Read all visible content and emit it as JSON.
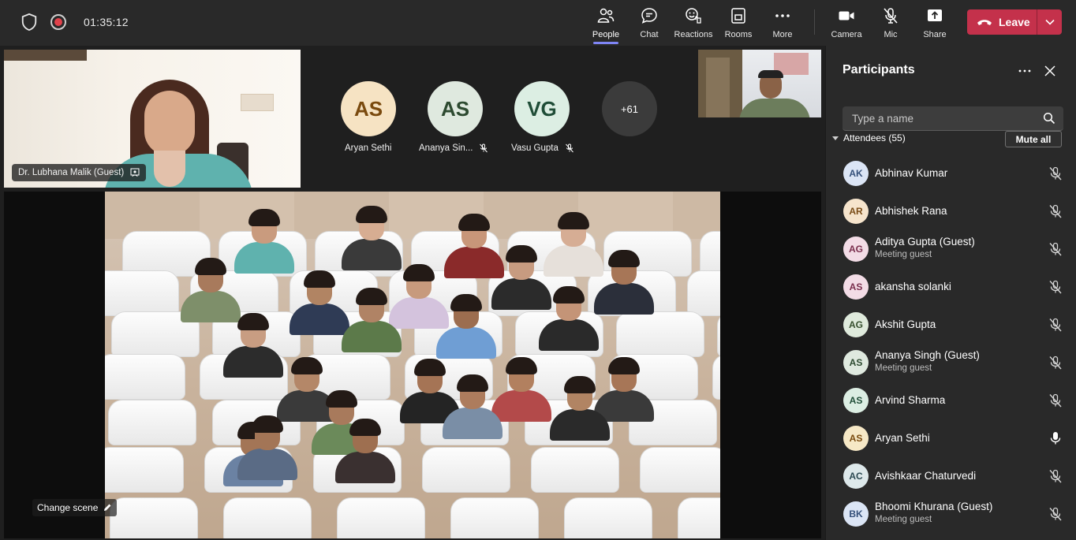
{
  "topbar": {
    "timer": "01:35:12",
    "buttons": {
      "people": "People",
      "chat": "Chat",
      "reactions": "Reactions",
      "rooms": "Rooms",
      "more": "More",
      "camera": "Camera",
      "mic": "Mic",
      "share": "Share"
    },
    "leave_label": "Leave",
    "leave_color": "#c4314b",
    "active_tab_color": "#7f85f5"
  },
  "stage": {
    "presenter_name": "Dr. Lubhana Malik (Guest)",
    "avatars": [
      {
        "initials": "AS",
        "name": "Aryan Sethi",
        "bg": "#f6e3c3",
        "fg": "#7a4a0e",
        "muted": false
      },
      {
        "initials": "AS",
        "name": "Ananya Sin...",
        "bg": "#dfe9df",
        "fg": "#2d4a30",
        "muted": true
      },
      {
        "initials": "VG",
        "name": "Vasu Gupta",
        "bg": "#dceee3",
        "fg": "#1f4d37",
        "muted": true
      }
    ],
    "overflow_count": "+61",
    "change_scene": "Change scene"
  },
  "panel": {
    "title": "Participants",
    "search_placeholder": "Type a name",
    "attendees_label": "Attendees (55)",
    "mute_all": "Mute all",
    "participants": [
      {
        "initials": "AK",
        "name": "Abhinav Kumar",
        "sub": "",
        "bg": "#dbe5f5",
        "fg": "#34507a",
        "mic": "muted"
      },
      {
        "initials": "AR",
        "name": "Abhishek Rana",
        "sub": "",
        "bg": "#f6e4cc",
        "fg": "#7a4c16",
        "mic": "muted"
      },
      {
        "initials": "AG",
        "name": "Aditya Gupta (Guest)",
        "sub": "Meeting guest",
        "bg": "#f3dce6",
        "fg": "#7a2e4d",
        "mic": "muted"
      },
      {
        "initials": "AS",
        "name": "akansha solanki",
        "sub": "",
        "bg": "#f3dce6",
        "fg": "#7a2e4d",
        "mic": "muted"
      },
      {
        "initials": "AG",
        "name": "Akshit Gupta",
        "sub": "",
        "bg": "#dfeadc",
        "fg": "#37502f",
        "mic": "muted"
      },
      {
        "initials": "AS",
        "name": "Ananya Singh (Guest)",
        "sub": "Meeting guest",
        "bg": "#dfe9df",
        "fg": "#2d4a30",
        "mic": "muted"
      },
      {
        "initials": "AS",
        "name": "Arvind Sharma",
        "sub": "",
        "bg": "#dceee3",
        "fg": "#1f4d37",
        "mic": "muted"
      },
      {
        "initials": "AS",
        "name": "Aryan Sethi",
        "sub": "",
        "bg": "#f6e8c6",
        "fg": "#7a4a0e",
        "mic": "on"
      },
      {
        "initials": "AC",
        "name": "Avishkaar Chaturvedi",
        "sub": "",
        "bg": "#dde8ea",
        "fg": "#2c4a52",
        "mic": "muted"
      },
      {
        "initials": "BK",
        "name": "Bhoomi Khurana (Guest)",
        "sub": "Meeting guest",
        "bg": "#dbe5f5",
        "fg": "#34507a",
        "mic": "muted"
      }
    ]
  }
}
